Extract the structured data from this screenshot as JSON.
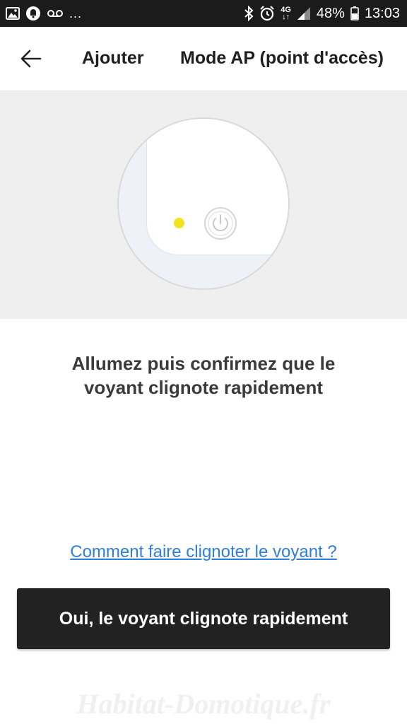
{
  "status_bar": {
    "icons_left": [
      "image-icon",
      "notification-icon",
      "voicemail-icon"
    ],
    "more": "...",
    "network": "4G",
    "battery": "48%",
    "time": "13:03"
  },
  "header": {
    "tab_add": "Ajouter",
    "tab_mode": "Mode AP (point d'accès)"
  },
  "illustration": {
    "led_color": "#f4e21f"
  },
  "instruction": {
    "line1": "Allumez puis confirmez que le",
    "line2": "voyant clignote rapidement"
  },
  "help_link": "Comment faire clignoter le voyant ?",
  "confirm_button": "Oui, le voyant clignote rapidement",
  "watermark": "Habitat-Domotique.fr"
}
